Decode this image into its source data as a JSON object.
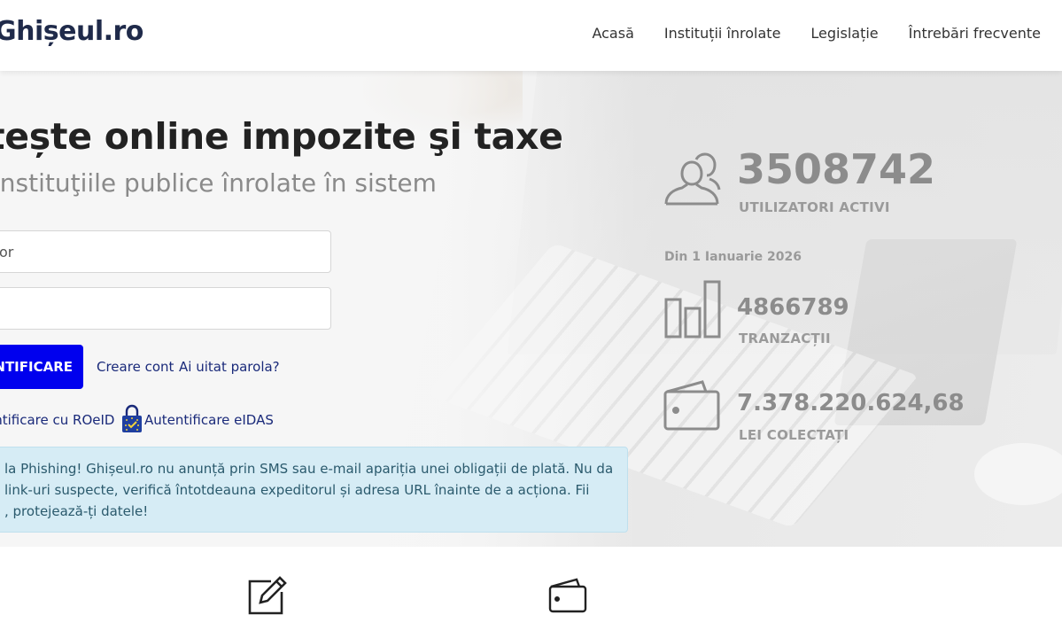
{
  "header": {
    "logo": "Ghișeul.ro",
    "nav": [
      "Acasă",
      "Instituții înrolate",
      "Legislație",
      "Întrebări frecvente"
    ]
  },
  "hero": {
    "title": "tește online impozite şi taxe",
    "subtitle": "instituţiile publice înrolate în sistem"
  },
  "login": {
    "user_placeholder": "or",
    "password_placeholder": "",
    "submit_label": "NTIFICARE",
    "create_account": "Creare cont",
    "forgot_password": "Ai uitat parola?",
    "roeid": "entificare cu ROeID",
    "eidas": "Autentificare eIDAS"
  },
  "alert": {
    "lines": [
      "la Phishing! Ghișeul.ro nu anunță prin SMS sau e-mail apariția unei obligații de plată. Nu da",
      "link-uri suspecte, verifică întotdeauna expeditorul și adresa URL înainte de a acționa. Fii",
      ", protejează-ți datele!"
    ]
  },
  "stats": {
    "users_value": "3508742",
    "users_label": "UTILIZATORI ACTIVI",
    "since": "Din 1 Ianuarie 2026",
    "transactions_value": "4866789",
    "transactions_label": "TRANZACȚII",
    "collected_value": "7.378.220.624,68",
    "collected_label": "LEI COLECTAȚI"
  },
  "icons": {
    "users": "users-icon",
    "chart": "bar-chart-icon",
    "wallet": "wallet-icon",
    "lock": "lock-icon",
    "edit": "edit-icon",
    "wallet_bottom": "wallet-icon"
  },
  "colors": {
    "primary_button": "#0000ee",
    "alert_bg": "#d6ecf5",
    "stat_gray": "#8c8c8c"
  }
}
